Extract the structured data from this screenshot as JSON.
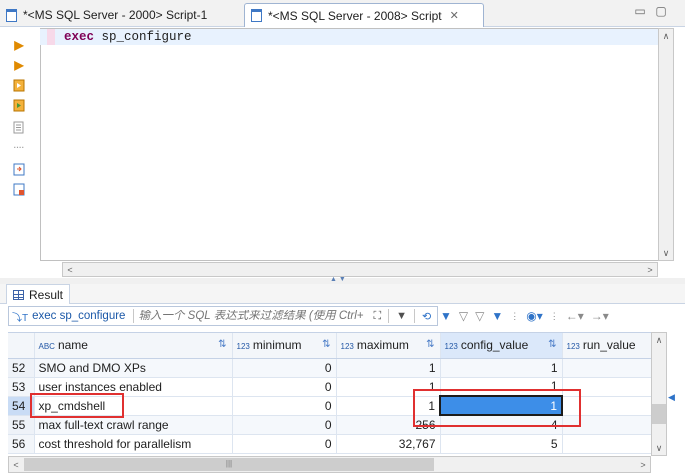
{
  "tabs": [
    {
      "label": "*<MS SQL Server - 2000> Script-1",
      "active": false
    },
    {
      "label": "*<MS SQL Server - 2008> Script",
      "active": true
    }
  ],
  "window": {
    "minimize": "▭",
    "maximize": "▢",
    "close_tab": "✕"
  },
  "editor": {
    "keyword": "exec",
    "procedure": "sp_configure"
  },
  "result": {
    "tab_label": "Result",
    "query_label": "exec sp_configure",
    "filter_placeholder": "输入一个 SQL 表达式来过滤结果 (使用 Ctrl+",
    "columns": [
      {
        "type": "ABC",
        "name": "name"
      },
      {
        "type": "123",
        "name": "minimum"
      },
      {
        "type": "123",
        "name": "maximum"
      },
      {
        "type": "123",
        "name": "config_value"
      },
      {
        "type": "123",
        "name": "run_value"
      }
    ],
    "rows": [
      {
        "n": "52",
        "name": "SMO and DMO XPs",
        "minimum": "0",
        "maximum": "1",
        "config_value": "1",
        "run_value": ""
      },
      {
        "n": "53",
        "name": "user instances enabled",
        "minimum": "0",
        "maximum": "1",
        "config_value": "1",
        "run_value": ""
      },
      {
        "n": "54",
        "name": "xp_cmdshell",
        "minimum": "0",
        "maximum": "1",
        "config_value": "1",
        "run_value": ""
      },
      {
        "n": "55",
        "name": "max full-text crawl range",
        "minimum": "0",
        "maximum": "256",
        "config_value": "4",
        "run_value": ""
      },
      {
        "n": "56",
        "name": "cost threshold for parallelism",
        "minimum": "0",
        "maximum": "32,767",
        "config_value": "5",
        "run_value": ""
      }
    ]
  },
  "colors": {
    "accent": "#2f73c8",
    "selection": "#3d8ee8",
    "annotation": "#e03030",
    "keyword": "#7f0055"
  }
}
